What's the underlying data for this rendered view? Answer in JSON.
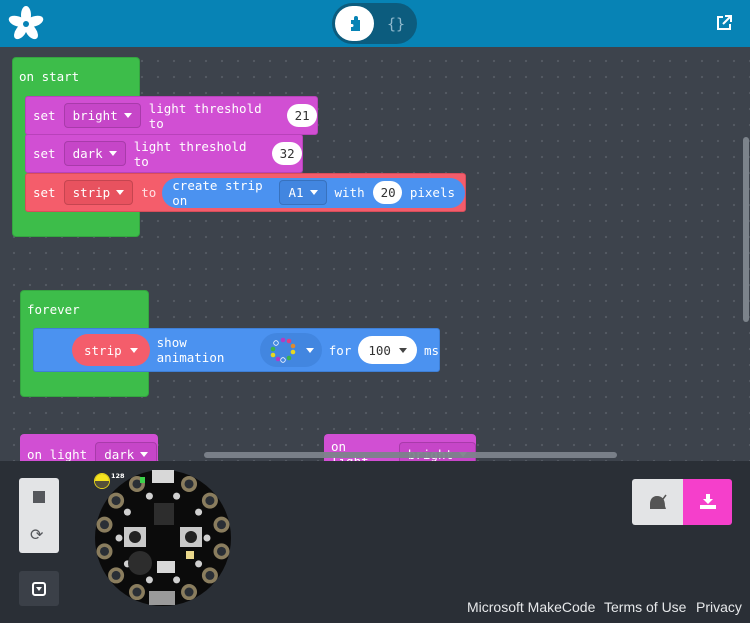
{
  "header": {
    "logo": "adafruit-flower-logo",
    "editor_toggle": {
      "blocks_icon": "puzzle-icon",
      "javascript_label": "{}",
      "active": "blocks"
    },
    "popout_icon": "external-link-icon"
  },
  "workspace": {
    "on_start": {
      "label": "on start",
      "statements": [
        {
          "keyword": "set",
          "dropdown": "bright",
          "text": "light threshold to",
          "value": "21"
        },
        {
          "keyword": "set",
          "dropdown": "dark",
          "text": "light threshold to",
          "value": "32"
        },
        {
          "keyword": "set",
          "dropdown": "strip",
          "to": "to",
          "create_text": "create strip on",
          "pin": "A1",
          "with": "with",
          "pixels_value": "20",
          "pixels_label": "pixels"
        }
      ]
    },
    "forever": {
      "label": "forever",
      "statement": {
        "variable": "strip",
        "text": "show animation",
        "animation_icon": "rainbow-ring-icon",
        "for": "for",
        "duration": "100",
        "unit": "ms"
      }
    },
    "on_light_dark": {
      "label": "on light",
      "dropdown": "dark"
    },
    "on_light_bright": {
      "label": "on light",
      "dropdown": "bright"
    }
  },
  "simulator": {
    "stop_icon": "stop-icon",
    "restart_icon": "restart-icon",
    "collapse_icon": "collapse-icon",
    "light_level": "128",
    "board": "circuit-playground-express"
  },
  "actions": {
    "slow_mode_icon": "snail-icon",
    "download_icon": "download-icon"
  },
  "footer": {
    "links": [
      "Microsoft MakeCode",
      "Terms of Use",
      "Privacy"
    ]
  },
  "colors": {
    "header": "#0783b5",
    "event_green": "#3dbd4a",
    "light_purple": "#d14fd3",
    "variables_red": "#f45d6b",
    "neopixel_blue": "#4b92f0",
    "download_pink": "#f53fcb"
  }
}
